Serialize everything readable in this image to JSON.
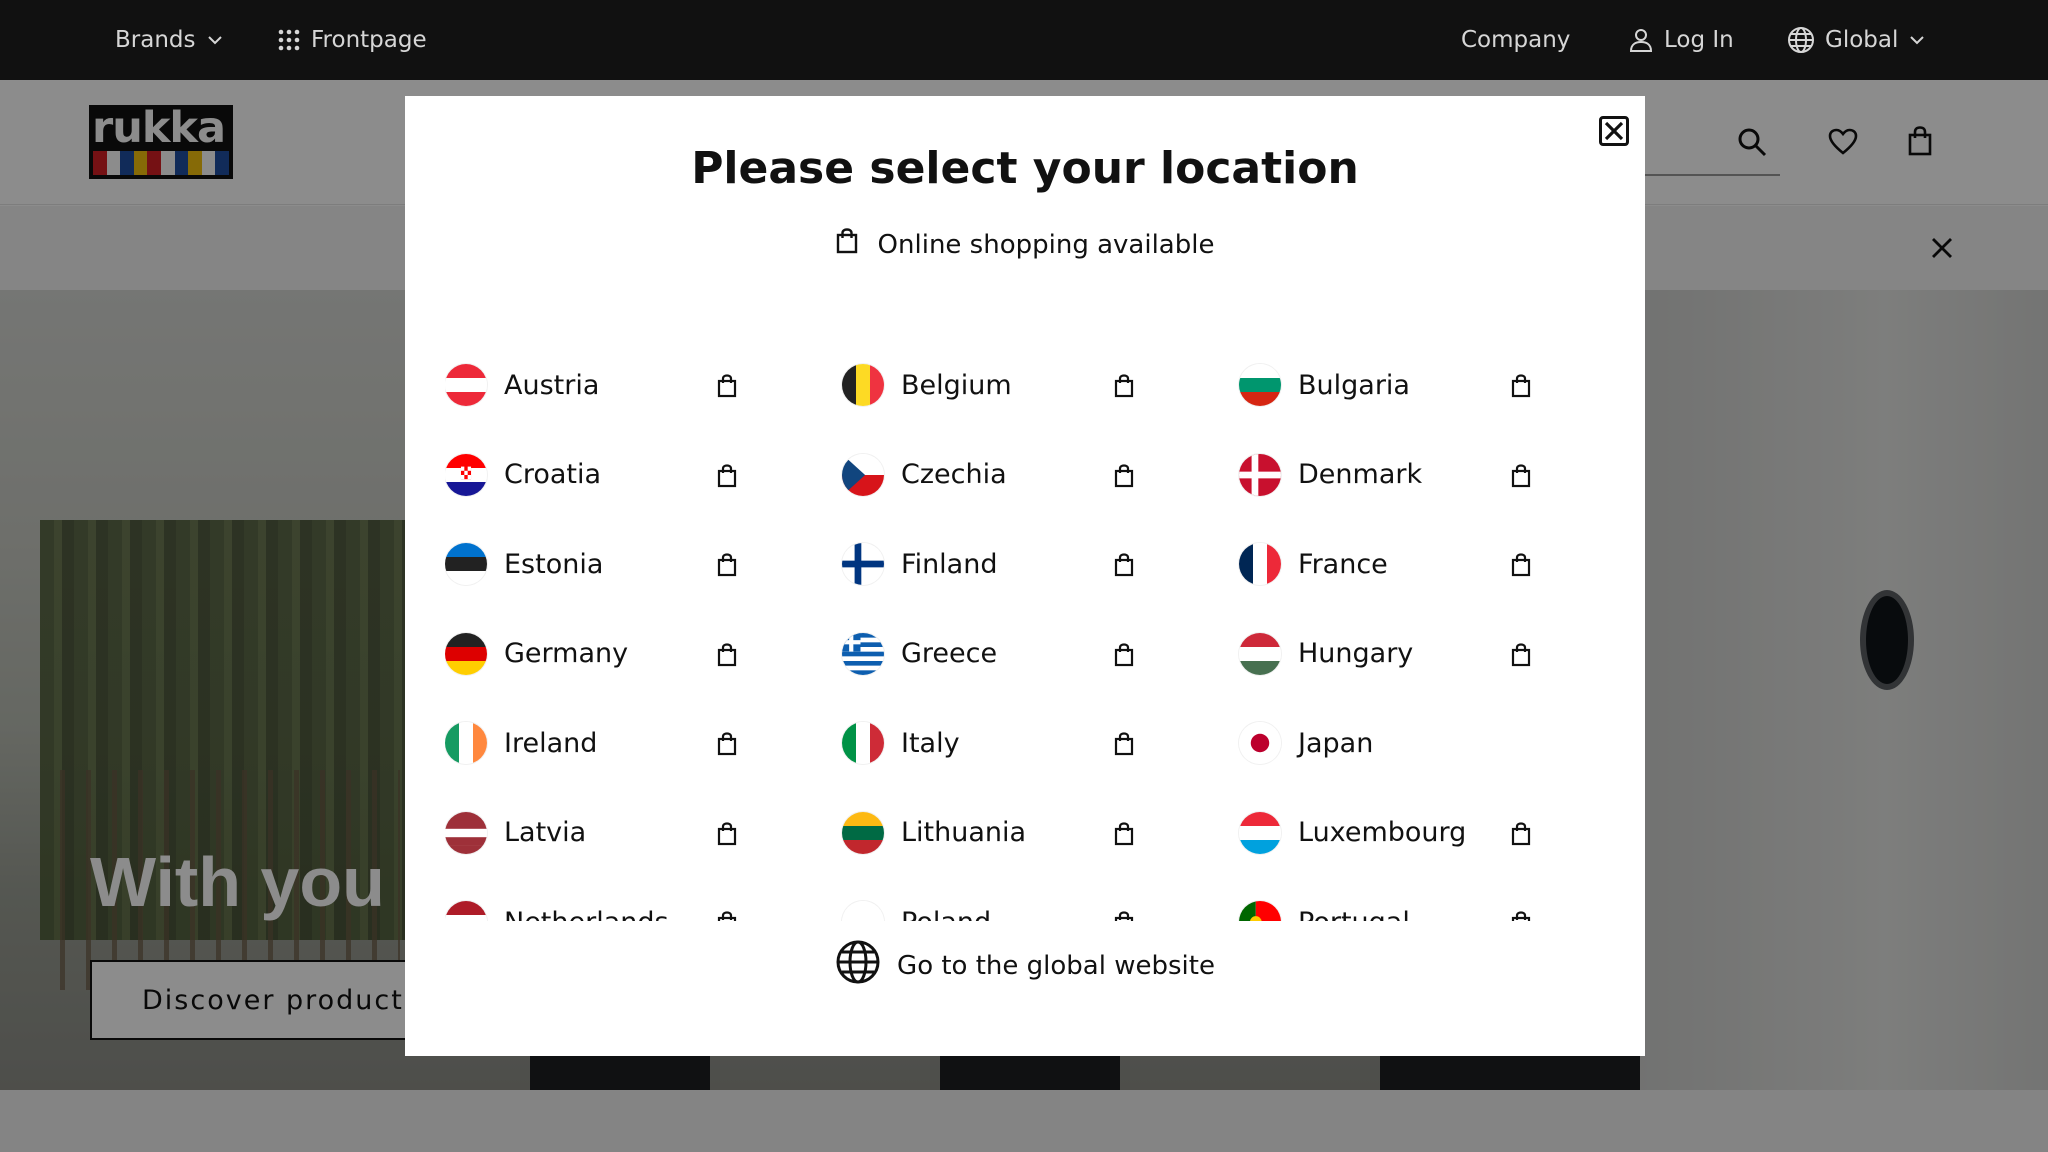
{
  "topbar": {
    "brands_label": "Brands",
    "frontpage_label": "Frontpage",
    "company_label": "Company",
    "login_label": "Log In",
    "region_label": "Global"
  },
  "header": {
    "logo_text": "rukka"
  },
  "hero": {
    "title": "With you a",
    "button_label": "Discover products"
  },
  "modal": {
    "title": "Please select your location",
    "subtitle": "Online shopping available",
    "global_link": "Go to the global website",
    "countries": [
      {
        "name": "Austria",
        "shop": true
      },
      {
        "name": "Belgium",
        "shop": true
      },
      {
        "name": "Bulgaria",
        "shop": true
      },
      {
        "name": "Croatia",
        "shop": true
      },
      {
        "name": "Czechia",
        "shop": true
      },
      {
        "name": "Denmark",
        "shop": true
      },
      {
        "name": "Estonia",
        "shop": true
      },
      {
        "name": "Finland",
        "shop": true
      },
      {
        "name": "France",
        "shop": true
      },
      {
        "name": "Germany",
        "shop": true
      },
      {
        "name": "Greece",
        "shop": true
      },
      {
        "name": "Hungary",
        "shop": true
      },
      {
        "name": "Ireland",
        "shop": true
      },
      {
        "name": "Italy",
        "shop": true
      },
      {
        "name": "Japan",
        "shop": false
      },
      {
        "name": "Latvia",
        "shop": true
      },
      {
        "name": "Lithuania",
        "shop": true
      },
      {
        "name": "Luxembourg",
        "shop": true
      },
      {
        "name": "Netherlands",
        "shop": true
      },
      {
        "name": "Poland",
        "shop": true
      },
      {
        "name": "Portugal",
        "shop": true
      }
    ]
  }
}
